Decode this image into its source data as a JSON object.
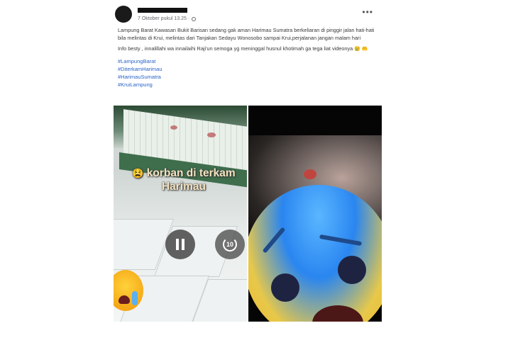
{
  "post": {
    "timestamp": "7 Oktober pukul 13.25",
    "paragraph1": "Lampung Barat Kawasan Bukit Barisan sedang gak aman Harimau Sumatra berkeliaran di pinggir jalan hati-hati bila melintas di Krui, melintas dari Tanjakan Sedayu Wonosobo sampai Krui,perjalanan jangan malam hari",
    "paragraph2": "Info besty , innalillahi wa innailaihi Raji'un semoga yg meninggal husnul khotimah ga tega liat videonya",
    "emoji": "😢 🤲",
    "hashtags": [
      "#LampungBarat",
      "#DiterkamHarimau",
      "#HarimauSumatra",
      "#KruiLampung"
    ]
  },
  "video": {
    "caption_emoji": "😫",
    "caption_line1": "korban di terkam",
    "caption_line2": "Harimau",
    "replay_label": "10"
  },
  "icons": {
    "more": "more-options-icon",
    "globe": "globe-icon",
    "pause": "pause-icon",
    "replay": "replay-10-icon"
  },
  "colors": {
    "hashtag": "#2a64c8",
    "meta_text": "#65676b",
    "caption": "#f3e3c0"
  }
}
